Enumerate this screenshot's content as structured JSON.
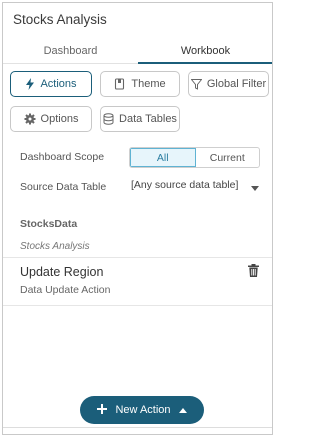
{
  "panel": {
    "title": "Stocks Analysis"
  },
  "tabs": [
    {
      "label": "Dashboard",
      "active": false
    },
    {
      "label": "Workbook",
      "active": true
    }
  ],
  "toolbar": {
    "actions_label": "Actions",
    "theme_label": "Theme",
    "global_filter_label": "Global Filter",
    "options_label": "Options",
    "data_tables_label": "Data Tables"
  },
  "scope": {
    "label": "Dashboard Scope",
    "options": [
      "All",
      "Current"
    ],
    "selected": "All"
  },
  "source": {
    "label": "Source Data Table",
    "value": "[Any source data table]"
  },
  "group": {
    "title": "StocksData",
    "subtitle": "Stocks Analysis"
  },
  "actions": [
    {
      "name": "Update Region",
      "type": "Data Update Action"
    }
  ],
  "new_action": {
    "label": "New Action"
  },
  "colors": {
    "accent": "#1b5e7a",
    "segment_on_bg": "#e7f5fb",
    "segment_on_border": "#5fb3d3"
  },
  "icons": [
    "bolt-icon",
    "theme-book-icon",
    "filter-icon",
    "gear-icon",
    "database-icon",
    "chevron-down-icon",
    "trash-icon",
    "plus-icon",
    "caret-up-icon"
  ]
}
